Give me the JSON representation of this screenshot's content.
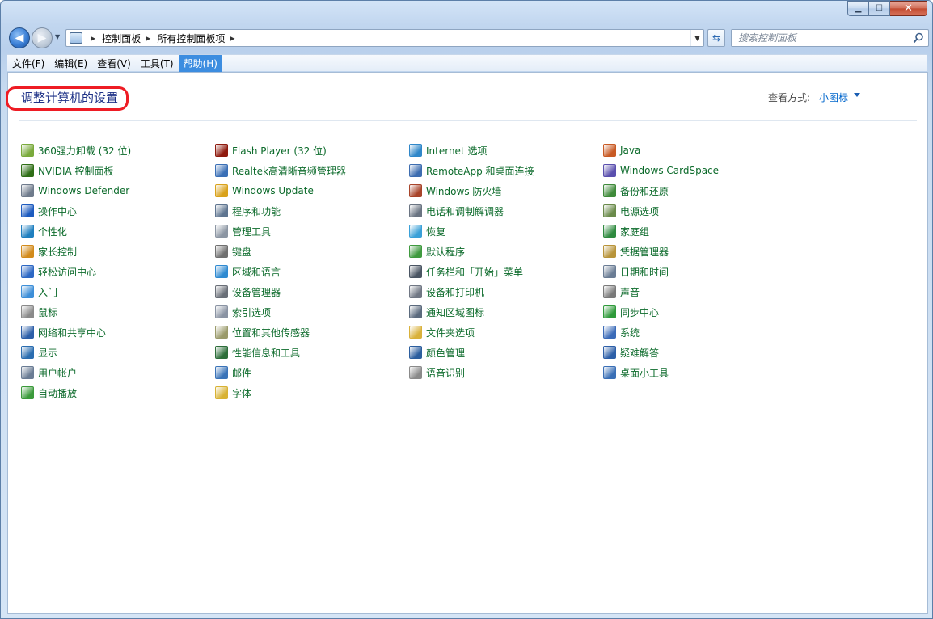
{
  "window": {
    "min_glyph": "▁",
    "max_glyph": "☐",
    "close_glyph": "✕"
  },
  "nav": {
    "back_glyph": "◀",
    "forward_glyph": "▶",
    "breadcrumb": [
      "控制面板",
      "所有控制面板项"
    ],
    "search_placeholder": "搜索控制面板"
  },
  "menu": [
    "文件(F)",
    "编辑(E)",
    "查看(V)",
    "工具(T)",
    "帮助(H)"
  ],
  "active_menu_index": 4,
  "page": {
    "title": "调整计算机的设置",
    "view_label": "查看方式:",
    "view_value": "小图标"
  },
  "columns": [
    [
      {
        "label": "360强力卸载 (32 位)",
        "icon": "uninstall-icon",
        "color": "#7aaa3c"
      },
      {
        "label": "NVIDIA 控制面板",
        "icon": "nvidia-icon",
        "color": "#2f6e16"
      },
      {
        "label": "Windows Defender",
        "icon": "defender-icon",
        "color": "#6f7b8c"
      },
      {
        "label": "操作中心",
        "icon": "flag-icon",
        "color": "#1d5bbf"
      },
      {
        "label": "个性化",
        "icon": "personalize-icon",
        "color": "#1f7fbf"
      },
      {
        "label": "家长控制",
        "icon": "parental-icon",
        "color": "#d28b1c"
      },
      {
        "label": "轻松访问中心",
        "icon": "ease-access-icon",
        "color": "#2d68c4"
      },
      {
        "label": "入门",
        "icon": "getting-started-icon",
        "color": "#3e8fd8"
      },
      {
        "label": "鼠标",
        "icon": "mouse-icon",
        "color": "#8a8a8a"
      },
      {
        "label": "网络和共享中心",
        "icon": "network-icon",
        "color": "#2d5fa8"
      },
      {
        "label": "显示",
        "icon": "display-icon",
        "color": "#2a6db0"
      },
      {
        "label": "用户帐户",
        "icon": "users-icon",
        "color": "#6a7c94"
      },
      {
        "label": "自动播放",
        "icon": "autoplay-icon",
        "color": "#3b9a3b"
      }
    ],
    [
      {
        "label": "Flash Player (32 位)",
        "icon": "flash-icon",
        "color": "#8e1a0e"
      },
      {
        "label": "Realtek高清晰音频管理器",
        "icon": "audio-manager-icon",
        "color": "#3a6fb6"
      },
      {
        "label": "Windows Update",
        "icon": "update-icon",
        "color": "#d9a21b"
      },
      {
        "label": "程序和功能",
        "icon": "programs-icon",
        "color": "#5f7590"
      },
      {
        "label": "管理工具",
        "icon": "admin-tools-icon",
        "color": "#8c96a3"
      },
      {
        "label": "键盘",
        "icon": "keyboard-icon",
        "color": "#707070"
      },
      {
        "label": "区域和语言",
        "icon": "region-icon",
        "color": "#2f8ad1"
      },
      {
        "label": "设备管理器",
        "icon": "device-manager-icon",
        "color": "#6a6f78"
      },
      {
        "label": "索引选项",
        "icon": "indexing-icon",
        "color": "#8a93a3"
      },
      {
        "label": "位置和其他传感器",
        "icon": "sensor-icon",
        "color": "#9a9a6a"
      },
      {
        "label": "性能信息和工具",
        "icon": "performance-icon",
        "color": "#2d6e3a"
      },
      {
        "label": "邮件",
        "icon": "mail-icon",
        "color": "#3a73b8"
      },
      {
        "label": "字体",
        "icon": "fonts-icon",
        "color": "#d8b233"
      }
    ],
    [
      {
        "label": "Internet 选项",
        "icon": "internet-icon",
        "color": "#2f87c9"
      },
      {
        "label": "RemoteApp 和桌面连接",
        "icon": "remoteapp-icon",
        "color": "#3d6db0"
      },
      {
        "label": "Windows 防火墙",
        "icon": "firewall-icon",
        "color": "#a8442a"
      },
      {
        "label": "电话和调制解调器",
        "icon": "phone-modem-icon",
        "color": "#6a7482"
      },
      {
        "label": "恢复",
        "icon": "recovery-icon",
        "color": "#3aa0d8"
      },
      {
        "label": "默认程序",
        "icon": "default-programs-icon",
        "color": "#3f9a3f"
      },
      {
        "label": "任务栏和「开始」菜单",
        "icon": "taskbar-icon",
        "color": "#4a5563"
      },
      {
        "label": "设备和打印机",
        "icon": "printer-icon",
        "color": "#707784"
      },
      {
        "label": "通知区域图标",
        "icon": "notification-icon",
        "color": "#5b6a7d"
      },
      {
        "label": "文件夹选项",
        "icon": "folder-options-icon",
        "color": "#d9b13a"
      },
      {
        "label": "颜色管理",
        "icon": "color-management-icon",
        "color": "#2c5e9e"
      },
      {
        "label": "语音识别",
        "icon": "microphone-icon",
        "color": "#8a8a8a"
      }
    ],
    [
      {
        "label": "Java",
        "icon": "java-icon",
        "color": "#c85a24"
      },
      {
        "label": "Windows CardSpace",
        "icon": "cardspace-icon",
        "color": "#5a4fae"
      },
      {
        "label": "备份和还原",
        "icon": "backup-icon",
        "color": "#3f8a3a"
      },
      {
        "label": "电源选项",
        "icon": "power-icon",
        "color": "#6a8a4a"
      },
      {
        "label": "家庭组",
        "icon": "homegroup-icon",
        "color": "#2f8a3f"
      },
      {
        "label": "凭据管理器",
        "icon": "credential-icon",
        "color": "#b8943a"
      },
      {
        "label": "日期和时间",
        "icon": "clock-icon",
        "color": "#6a7c94"
      },
      {
        "label": "声音",
        "icon": "speaker-icon",
        "color": "#7a7a7a"
      },
      {
        "label": "同步中心",
        "icon": "sync-icon",
        "color": "#2f9a3a"
      },
      {
        "label": "系统",
        "icon": "system-icon",
        "color": "#3b6bb8"
      },
      {
        "label": "疑难解答",
        "icon": "troubleshoot-icon",
        "color": "#2d5fa8"
      },
      {
        "label": "桌面小工具",
        "icon": "gadgets-icon",
        "color": "#3a6fb6"
      }
    ]
  ]
}
